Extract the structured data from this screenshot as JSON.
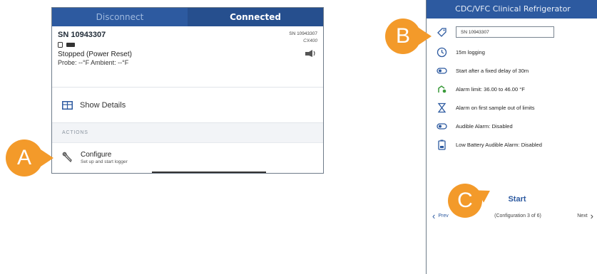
{
  "left_panel": {
    "tabs": {
      "disconnect": "Disconnect",
      "connected": "Connected"
    },
    "device": {
      "serial": "SN 10943307",
      "serial_right": "SN 10943307",
      "model": "CX400",
      "state": "Stopped (Power Reset)",
      "probe": "Probe: --°F  Ambient: --°F"
    },
    "show_details_label": "Show Details",
    "actions_header": "ACTIONS",
    "configure": {
      "title": "Configure",
      "subtitle": "Set up and start logger"
    }
  },
  "right_panel": {
    "title": "CDC/VFC Clinical Refrigerator",
    "name_value": "SN 10943307",
    "rows": [
      {
        "icon": "clock-icon",
        "text": "15m logging"
      },
      {
        "icon": "delay-start-icon",
        "text": "Start after a fixed delay of 30m"
      },
      {
        "icon": "thermometer-alarm-icon",
        "text": "Alarm limit: 36.00 to 46.00 °F"
      },
      {
        "icon": "hourglass-icon",
        "text": "Alarm on first sample out of limits"
      },
      {
        "icon": "speaker-icon",
        "text": "Audible Alarm: Disabled"
      },
      {
        "icon": "battery-alarm-icon",
        "text": "Low Battery Audible Alarm: Disabled"
      }
    ],
    "start_label": "Start",
    "prev_label": "Prev",
    "page_indicator": "(Configuration 3 of 6)",
    "next_label": "Next"
  },
  "callouts": {
    "a": "A",
    "b": "B",
    "c": "C"
  },
  "colors": {
    "accent": "#2d5aa0",
    "callout": "#f39a2a"
  }
}
